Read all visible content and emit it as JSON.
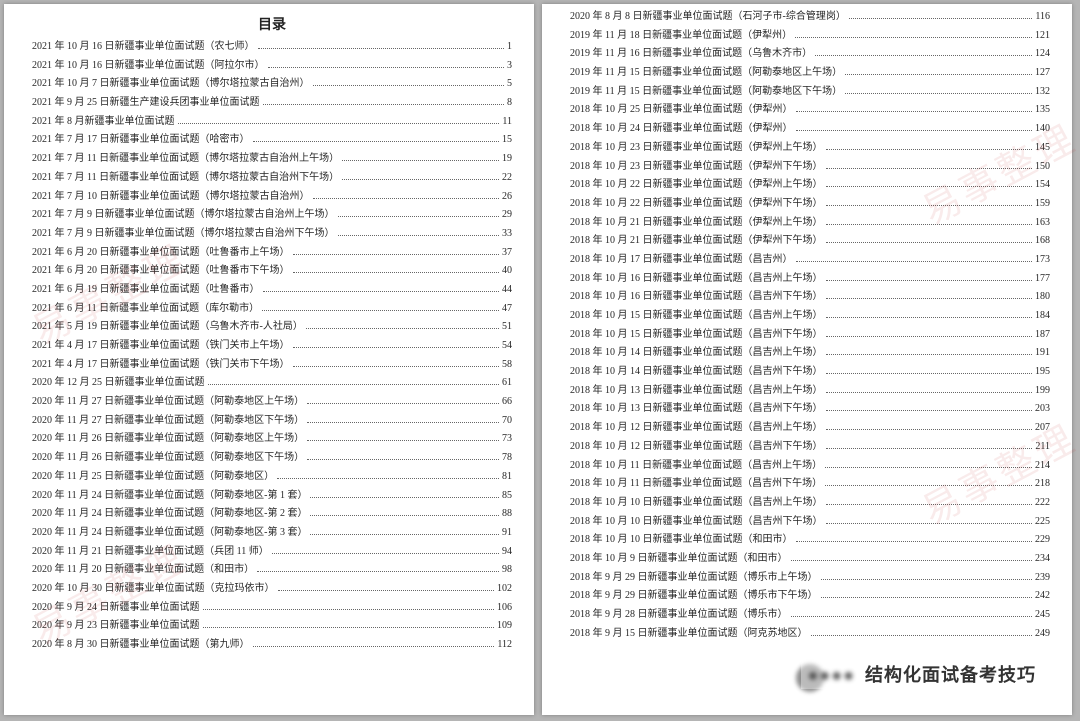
{
  "title": "目录",
  "watermark_text": "易事整理",
  "overlay_text_clear": "结构化面试备考技巧",
  "left": [
    {
      "label": "2021 年 10 月 16 日新疆事业单位面试题（农七师）",
      "page": "1"
    },
    {
      "label": "2021 年 10 月 16 日新疆事业单位面试题（阿拉尔市）",
      "page": "3"
    },
    {
      "label": "2021 年 10 月 7 日新疆事业单位面试题（博尔塔拉蒙古自治州）",
      "page": "5"
    },
    {
      "label": "2021 年 9 月 25 日新疆生产建设兵团事业单位面试题",
      "page": "8"
    },
    {
      "label": "2021 年 8 月新疆事业单位面试题",
      "page": "11"
    },
    {
      "label": "2021 年 7 月 17 日新疆事业单位面试题（哈密市）",
      "page": "15"
    },
    {
      "label": "2021 年 7 月 11 日新疆事业单位面试题（博尔塔拉蒙古自治州上午场）",
      "page": "19"
    },
    {
      "label": "2021 年 7 月 11 日新疆事业单位面试题（博尔塔拉蒙古自治州下午场）",
      "page": "22"
    },
    {
      "label": "2021 年 7 月 10 日新疆事业单位面试题（博尔塔拉蒙古自治州）",
      "page": "26"
    },
    {
      "label": "2021 年 7 月 9 日新疆事业单位面试题（博尔塔拉蒙古自治州上午场）",
      "page": "29"
    },
    {
      "label": "2021 年 7 月 9 日新疆事业单位面试题（博尔塔拉蒙古自治州下午场）",
      "page": "33"
    },
    {
      "label": "2021 年 6 月 20 日新疆事业单位面试题（吐鲁番市上午场）",
      "page": "37"
    },
    {
      "label": "2021 年 6 月 20 日新疆事业单位面试题（吐鲁番市下午场）",
      "page": "40"
    },
    {
      "label": "2021 年 6 月 19 日新疆事业单位面试题（吐鲁番市）",
      "page": "44"
    },
    {
      "label": "2021 年 6 月 11 日新疆事业单位面试题（库尔勒市）",
      "page": "47"
    },
    {
      "label": "2021 年 5 月 19 日新疆事业单位面试题（乌鲁木齐市-人社局）",
      "page": "51"
    },
    {
      "label": "2021 年 4 月 17 日新疆事业单位面试题（铁门关市上午场）",
      "page": "54"
    },
    {
      "label": "2021 年 4 月 17 日新疆事业单位面试题（铁门关市下午场）",
      "page": "58"
    },
    {
      "label": "2020 年 12 月 25 日新疆事业单位面试题",
      "page": "61"
    },
    {
      "label": "2020 年 11 月 27 日新疆事业单位面试题（阿勒泰地区上午场）",
      "page": "66"
    },
    {
      "label": "2020 年 11 月 27 日新疆事业单位面试题（阿勒泰地区下午场）",
      "page": "70"
    },
    {
      "label": "2020 年 11 月 26 日新疆事业单位面试题（阿勒泰地区上午场）",
      "page": "73"
    },
    {
      "label": "2020 年 11 月 26 日新疆事业单位面试题（阿勒泰地区下午场）",
      "page": "78"
    },
    {
      "label": "2020 年 11 月 25 日新疆事业单位面试题（阿勒泰地区）",
      "page": "81"
    },
    {
      "label": "2020 年 11 月 24 日新疆事业单位面试题（阿勒泰地区-第 1 套）",
      "page": "85"
    },
    {
      "label": "2020 年 11 月 24 日新疆事业单位面试题（阿勒泰地区-第 2 套）",
      "page": "88"
    },
    {
      "label": "2020 年 11 月 24 日新疆事业单位面试题（阿勒泰地区-第 3 套）",
      "page": "91"
    },
    {
      "label": "2020 年 11 月 21 日新疆事业单位面试题（兵团 11 师）",
      "page": "94"
    },
    {
      "label": "2020 年 11 月 20 日新疆事业单位面试题（和田市）",
      "page": "98"
    },
    {
      "label": "2020 年 10 月 30 日新疆事业单位面试题（克拉玛依市）",
      "page": "102"
    },
    {
      "label": "2020 年 9 月 24 日新疆事业单位面试题",
      "page": "106"
    },
    {
      "label": "2020 年 9 月 23 日新疆事业单位面试题",
      "page": "109"
    },
    {
      "label": "2020 年 8 月 30 日新疆事业单位面试题（第九师）",
      "page": "112"
    }
  ],
  "right": [
    {
      "label": "2020 年 8 月 8 日新疆事业单位面试题（石河子市-综合管理岗）",
      "page": "116"
    },
    {
      "label": "2019 年 11 月 18 日新疆事业单位面试题（伊犁州）",
      "page": "121"
    },
    {
      "label": "2019 年 11 月 16 日新疆事业单位面试题（乌鲁木齐市）",
      "page": "124"
    },
    {
      "label": "2019 年 11 月 15 日新疆事业单位面试题（阿勒泰地区上午场）",
      "page": "127"
    },
    {
      "label": "2019 年 11 月 15 日新疆事业单位面试题（阿勒泰地区下午场）",
      "page": "132"
    },
    {
      "label": "2018 年 10 月 25 日新疆事业单位面试题（伊犁州）",
      "page": "135"
    },
    {
      "label": "2018 年 10 月 24 日新疆事业单位面试题（伊犁州）",
      "page": "140"
    },
    {
      "label": "2018 年 10 月 23 日新疆事业单位面试题（伊犁州上午场）",
      "page": "145"
    },
    {
      "label": "2018 年 10 月 23 日新疆事业单位面试题（伊犁州下午场）",
      "page": "150"
    },
    {
      "label": "2018 年 10 月 22 日新疆事业单位面试题（伊犁州上午场）",
      "page": "154"
    },
    {
      "label": "2018 年 10 月 22 日新疆事业单位面试题（伊犁州下午场）",
      "page": "159"
    },
    {
      "label": "2018 年 10 月 21 日新疆事业单位面试题（伊犁州上午场）",
      "page": "163"
    },
    {
      "label": "2018 年 10 月 21 日新疆事业单位面试题（伊犁州下午场）",
      "page": "168"
    },
    {
      "label": "2018 年 10 月 17 日新疆事业单位面试题（昌吉州）",
      "page": "173"
    },
    {
      "label": "2018 年 10 月 16 日新疆事业单位面试题（昌吉州上午场）",
      "page": "177"
    },
    {
      "label": "2018 年 10 月 16 日新疆事业单位面试题（昌吉州下午场）",
      "page": "180"
    },
    {
      "label": "2018 年 10 月 15 日新疆事业单位面试题（昌吉州上午场）",
      "page": "184"
    },
    {
      "label": "2018 年 10 月 15 日新疆事业单位面试题（昌吉州下午场）",
      "page": "187"
    },
    {
      "label": "2018 年 10 月 14 日新疆事业单位面试题（昌吉州上午场）",
      "page": "191"
    },
    {
      "label": "2018 年 10 月 14 日新疆事业单位面试题（昌吉州下午场）",
      "page": "195"
    },
    {
      "label": "2018 年 10 月 13 日新疆事业单位面试题（昌吉州上午场）",
      "page": "199"
    },
    {
      "label": "2018 年 10 月 13 日新疆事业单位面试题（昌吉州下午场）",
      "page": "203"
    },
    {
      "label": "2018 年 10 月 12 日新疆事业单位面试题（昌吉州上午场）",
      "page": "207"
    },
    {
      "label": "2018 年 10 月 12 日新疆事业单位面试题（昌吉州下午场）",
      "page": "211"
    },
    {
      "label": "2018 年 10 月 11 日新疆事业单位面试题（昌吉州上午场）",
      "page": "214"
    },
    {
      "label": "2018 年 10 月 11 日新疆事业单位面试题（昌吉州下午场）",
      "page": "218"
    },
    {
      "label": "2018 年 10 月 10 日新疆事业单位面试题（昌吉州上午场）",
      "page": "222"
    },
    {
      "label": "2018 年 10 月 10 日新疆事业单位面试题（昌吉州下午场）",
      "page": "225"
    },
    {
      "label": "2018 年 10 月 10 日新疆事业单位面试题（和田市）",
      "page": "229"
    },
    {
      "label": "2018 年 10 月 9 日新疆事业单位面试题（和田市）",
      "page": "234"
    },
    {
      "label": "2018 年 9 月 29 日新疆事业单位面试题（博乐市上午场）",
      "page": "239"
    },
    {
      "label": "2018 年 9 月 29 日新疆事业单位面试题（博乐市下午场）",
      "page": "242"
    },
    {
      "label": "2018 年 9 月 28 日新疆事业单位面试题（博乐市）",
      "page": "245"
    },
    {
      "label": "2018 年 9 月 15 日新疆事业单位面试题（阿克苏地区）",
      "page": "249"
    }
  ]
}
